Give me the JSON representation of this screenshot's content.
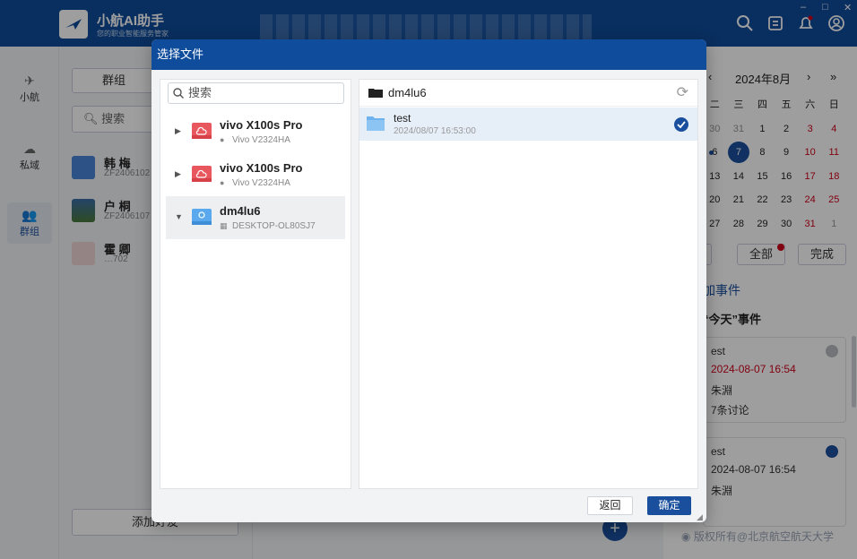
{
  "app": {
    "title": "小航AI助手",
    "subtitle": "您的职业智能服务管家"
  },
  "nav": [
    {
      "label": "小航",
      "icon": "plane-icon"
    },
    {
      "label": "私域",
      "icon": "chat-icon"
    },
    {
      "label": "群组",
      "icon": "group-icon"
    }
  ],
  "contacts": {
    "tab_label": "群组",
    "search_placeholder": "搜索",
    "items": [
      {
        "name": "韩 梅",
        "id": "ZF2406102"
      },
      {
        "name": "户 桐",
        "id": "ZF2406107"
      },
      {
        "name": "霍 卿",
        "id": "…702"
      }
    ],
    "add_label": "添加好友"
  },
  "calendar": {
    "month_label": "2024年8月",
    "prev": "‹",
    "next": "›",
    "next_year": "»",
    "weekdays": [
      "二",
      "三",
      "四",
      "五",
      "六",
      "日"
    ],
    "rows": [
      [
        "30",
        "31",
        "1",
        "2",
        "3",
        "4"
      ],
      [
        "6",
        "7",
        "8",
        "9",
        "10",
        "11"
      ],
      [
        "13",
        "14",
        "15",
        "16",
        "17",
        "18"
      ],
      [
        "20",
        "21",
        "22",
        "23",
        "24",
        "25"
      ],
      [
        "27",
        "28",
        "29",
        "30",
        "31",
        "1"
      ]
    ],
    "btn_today": "天",
    "btn_all": "全部",
    "btn_done": "完成",
    "add_event_link": "加事件",
    "section_title": "“今天”事件",
    "events": [
      {
        "title": "est",
        "time": "2024-08-07 16:54",
        "owner": "朱淵",
        "discussion": "7条讨论"
      },
      {
        "title": "est",
        "time": "2024-08-07 16:54",
        "owner": "朱淵"
      }
    ],
    "copyright": "版权所有@北京航空航天大学"
  },
  "dialog": {
    "title": "选择文件",
    "search_placeholder": "搜索",
    "devices": [
      {
        "name": "vivo X100s Pro",
        "sub": "Vivo V2324HA",
        "color": "#e8565e",
        "os": "android"
      },
      {
        "name": "vivo X100s Pro",
        "sub": "Vivo V2324HA",
        "color": "#e8565e",
        "os": "android"
      },
      {
        "name": "dm4lu6",
        "sub": "DESKTOP-OL80SJ7",
        "color": "#5aa8ee",
        "os": "windows"
      }
    ],
    "current_folder": "dm4lu6",
    "files": [
      {
        "name": "test",
        "date": "2024/08/07 16:53:00"
      }
    ],
    "back_label": "返回",
    "ok_label": "确定"
  },
  "colors": {
    "primary": "#0f4c9c",
    "accent": "#1a4f9e",
    "danger": "#d0021b"
  }
}
